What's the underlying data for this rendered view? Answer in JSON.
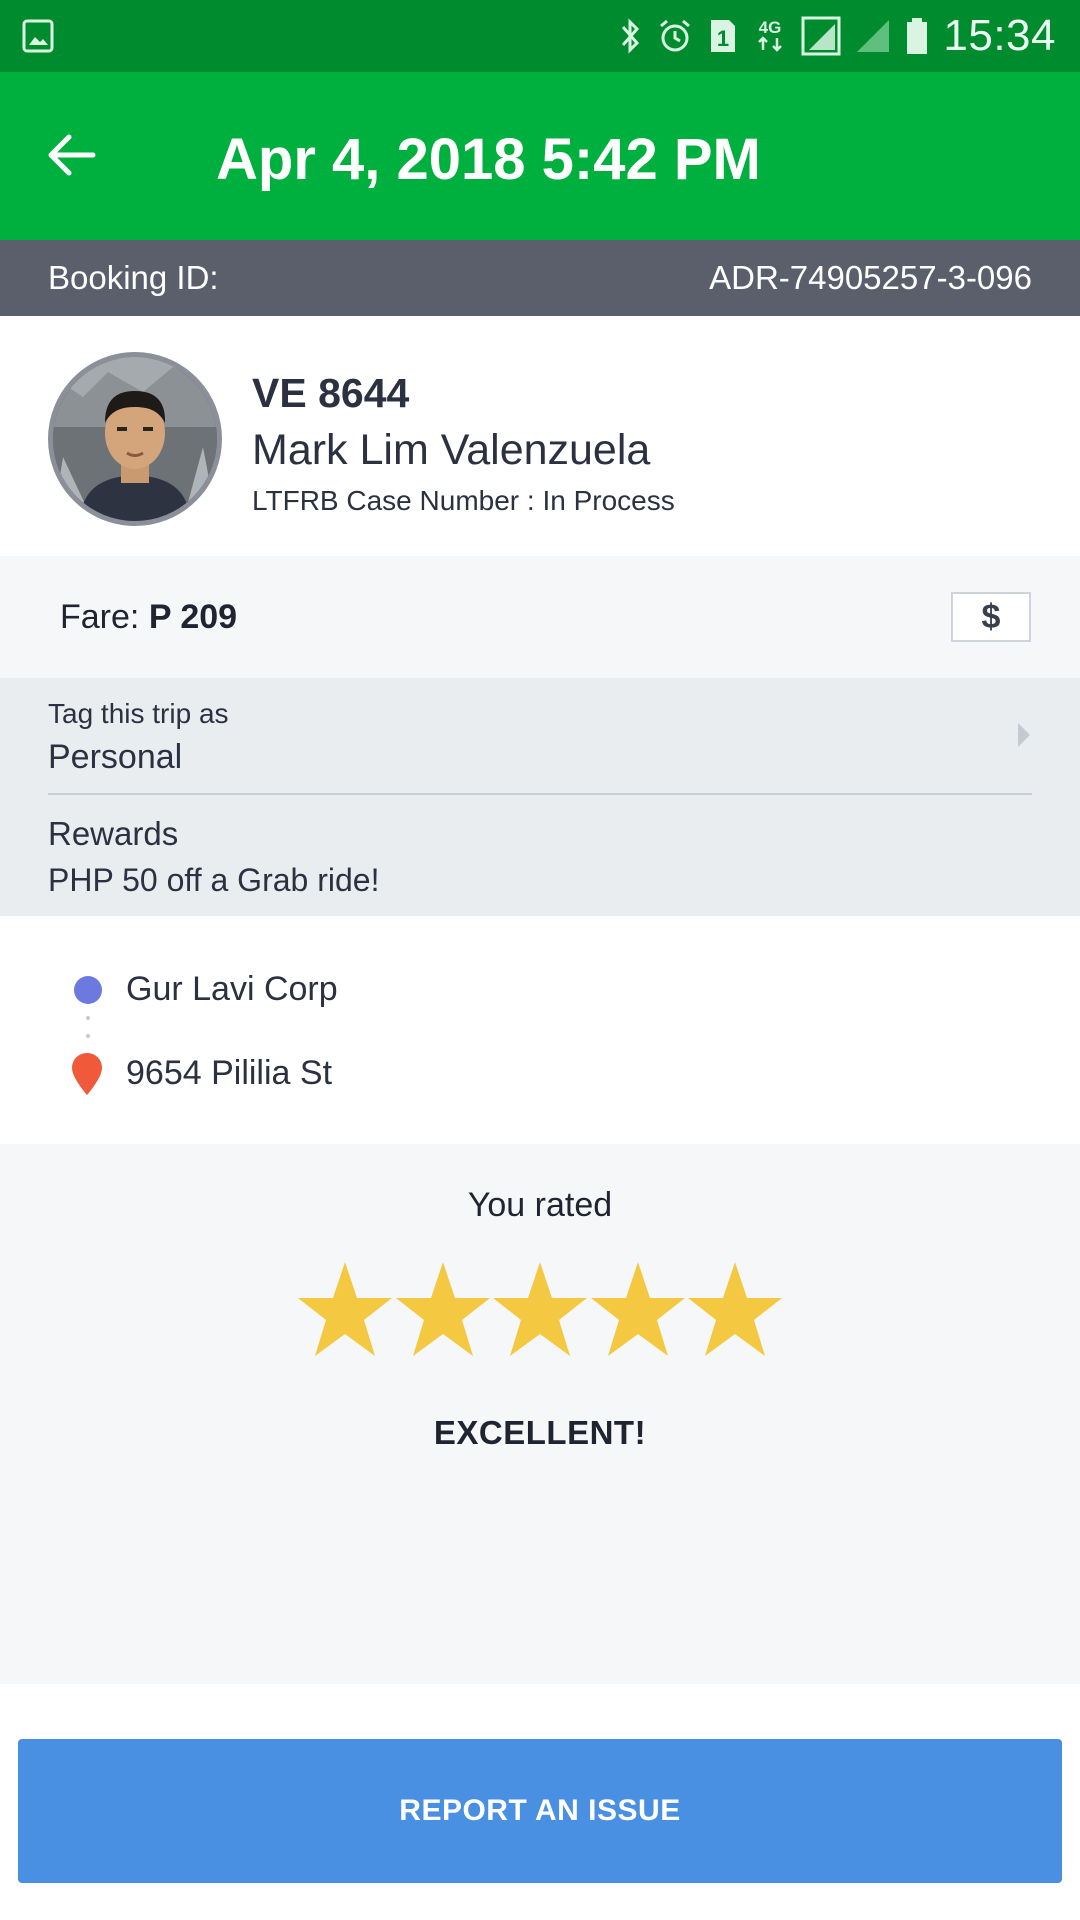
{
  "status_bar": {
    "time": "15:34",
    "network_label": "4G",
    "sim_slot": "1",
    "icons": [
      "image-icon",
      "bluetooth-icon",
      "alarm-icon",
      "sim-1-icon",
      "4g-data-icon",
      "signal-icon",
      "signal-icon",
      "battery-icon"
    ]
  },
  "app_bar": {
    "title": "Apr 4, 2018 5:42 PM",
    "back_icon": "arrow-left-icon",
    "background": "#00b03f"
  },
  "booking": {
    "label": "Booking ID:",
    "id": "ADR-74905257-3-096"
  },
  "driver": {
    "plate": "VE 8644",
    "name": "Mark Lim Valenzuela",
    "case_number": "LTFRB Case Number : In Process"
  },
  "fare": {
    "label": "Fare:",
    "value": "P 209",
    "payment_icon": "$"
  },
  "trip_tag": {
    "label": "Tag this trip as",
    "value": "Personal"
  },
  "rewards": {
    "label": "Rewards",
    "value": "PHP 50 off a Grab ride!"
  },
  "route": {
    "pickup": "Gur Lavi Corp",
    "dropoff": "9654 Pililia St",
    "pickup_color": "#6c7ae0",
    "dropoff_color": "#f05a3a"
  },
  "rating": {
    "label": "You rated",
    "stars": 5,
    "max_stars": 5,
    "text": "EXCELLENT!",
    "star_color": "#f5c842"
  },
  "actions": {
    "report_label": "REPORT AN ISSUE",
    "report_color": "#4a90e2"
  }
}
